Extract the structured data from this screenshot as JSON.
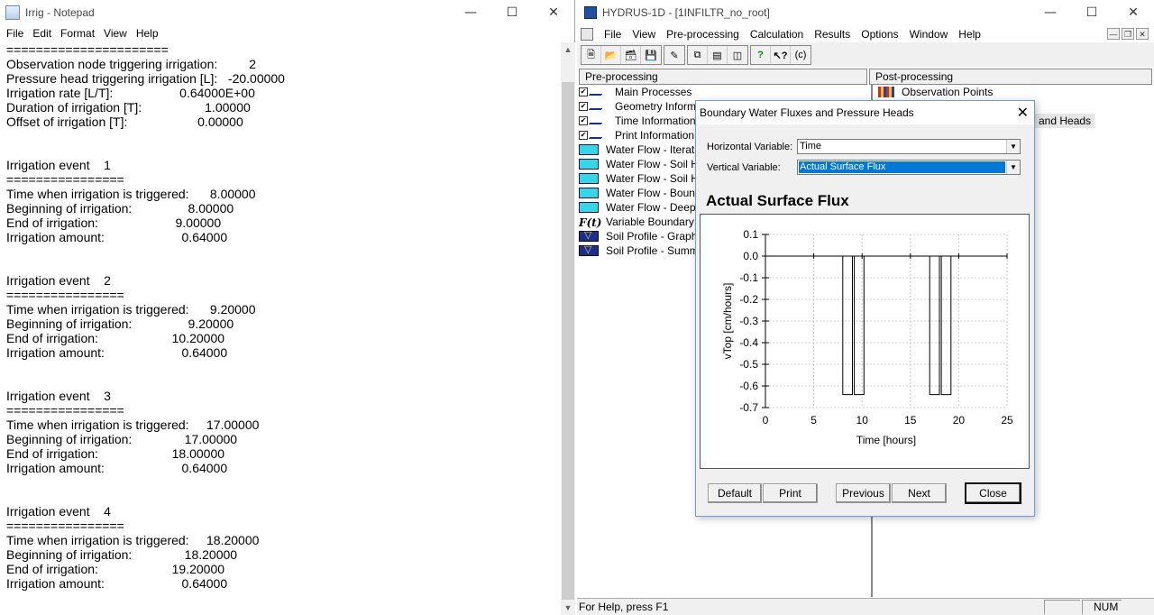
{
  "notepad": {
    "title": "Irrig - Notepad",
    "menu": [
      "File",
      "Edit",
      "Format",
      "View",
      "Help"
    ],
    "lines": [
      "======================",
      "Observation node triggering irrigation:         2",
      "Pressure head triggering irrigation [L]:   -20.00000",
      "Irrigation rate [L/T]:                   0.64000E+00",
      "Duration of irrigation [T]:                  1.00000",
      "Offset of irrigation [T]:                    0.00000",
      "",
      "",
      "Irrigation event    1",
      "================",
      "Time when irrigation is triggered:      8.00000",
      "Beginning of irrigation:                8.00000",
      "End of irrigation:                      9.00000",
      "Irrigation amount:                      0.64000",
      "",
      "",
      "Irrigation event    2",
      "================",
      "Time when irrigation is triggered:      9.20000",
      "Beginning of irrigation:                9.20000",
      "End of irrigation:                     10.20000",
      "Irrigation amount:                      0.64000",
      "",
      "",
      "Irrigation event    3",
      "================",
      "Time when irrigation is triggered:     17.00000",
      "Beginning of irrigation:               17.00000",
      "End of irrigation:                     18.00000",
      "Irrigation amount:                      0.64000",
      "",
      "",
      "Irrigation event    4",
      "================",
      "Time when irrigation is triggered:     18.20000",
      "Beginning of irrigation:               18.20000",
      "End of irrigation:                     19.20000",
      "Irrigation amount:                      0.64000"
    ]
  },
  "hydrus": {
    "title": "HYDRUS-1D - [1INFILTR_no_root]",
    "menu": [
      "File",
      "View",
      "Pre-processing",
      "Calculation",
      "Results",
      "Options",
      "Window",
      "Help"
    ],
    "toolbar_help_text": "(c)",
    "pre_header": "Pre-processing",
    "post_header": "Post-processing",
    "pre_items": [
      {
        "label": "Main Processes",
        "icon": "pen-icon"
      },
      {
        "label": "Geometry Informati",
        "icon": "pen-icon"
      },
      {
        "label": "Time Information",
        "icon": "pen-icon"
      },
      {
        "label": "Print Information",
        "icon": "pen-icon"
      },
      {
        "label": "Water Flow - Iterati",
        "icon": "water-icon"
      },
      {
        "label": "Water Flow - Soil H",
        "icon": "water-icon"
      },
      {
        "label": "Water Flow - Soil H",
        "icon": "water-icon"
      },
      {
        "label": "Water Flow - Bound",
        "icon": "water-icon"
      },
      {
        "label": "Water Flow - Deep D",
        "icon": "water-icon"
      },
      {
        "label": "Variable Boundary C",
        "icon": "function-icon"
      },
      {
        "label": "Soil Profile - Graphi",
        "icon": "soil-profile-icon"
      },
      {
        "label": "Soil Profile - Summ",
        "icon": "soil-profile-icon"
      }
    ],
    "fx_glyph": "F(t)",
    "post_items": [
      {
        "label": "Observation Points",
        "icon": "observation-icon"
      }
    ],
    "post_partial": "and Heads",
    "status": {
      "help": "For Help, press F1",
      "num": "NUM"
    }
  },
  "dialog": {
    "title": "Boundary Water Fluxes and Pressure Heads",
    "horizontal_label": "Horizontal Variable:",
    "horizontal_value": "Time",
    "vertical_label": "Vertical Variable:",
    "vertical_value": "Actual Surface Flux",
    "chart_heading": "Actual Surface Flux",
    "buttons": {
      "default": "Default",
      "print": "Print",
      "previous": "Previous",
      "next": "Next",
      "close": "Close"
    }
  },
  "chart_data": {
    "type": "line",
    "title": "Actual Surface Flux",
    "xlabel": "Time [hours]",
    "ylabel": "vTop [cm/hours]",
    "xlim": [
      0,
      25
    ],
    "ylim": [
      -0.7,
      0.1
    ],
    "xticks": [
      0,
      5,
      10,
      15,
      20,
      25
    ],
    "yticks": [
      0.1,
      0.0,
      -0.1,
      -0.2,
      -0.3,
      -0.4,
      -0.5,
      -0.6,
      -0.7
    ],
    "ytick_labels": [
      "0.1",
      "0.0",
      "-0.1",
      "-0.2",
      "-0.3",
      "-0.4",
      "-0.5",
      "-0.6",
      "-0.7"
    ],
    "grid": true,
    "series": [
      {
        "color": "#000000",
        "x": [
          0,
          8,
          8,
          9,
          9,
          9.2,
          9.2,
          10.2,
          10.2,
          17,
          17,
          18,
          18,
          18.2,
          18.2,
          19.2,
          19.2,
          25
        ],
        "y": [
          0,
          0,
          -0.64,
          -0.64,
          0,
          0,
          -0.64,
          -0.64,
          0,
          0,
          -0.64,
          -0.64,
          0,
          0,
          -0.64,
          -0.64,
          0,
          0
        ]
      }
    ]
  }
}
